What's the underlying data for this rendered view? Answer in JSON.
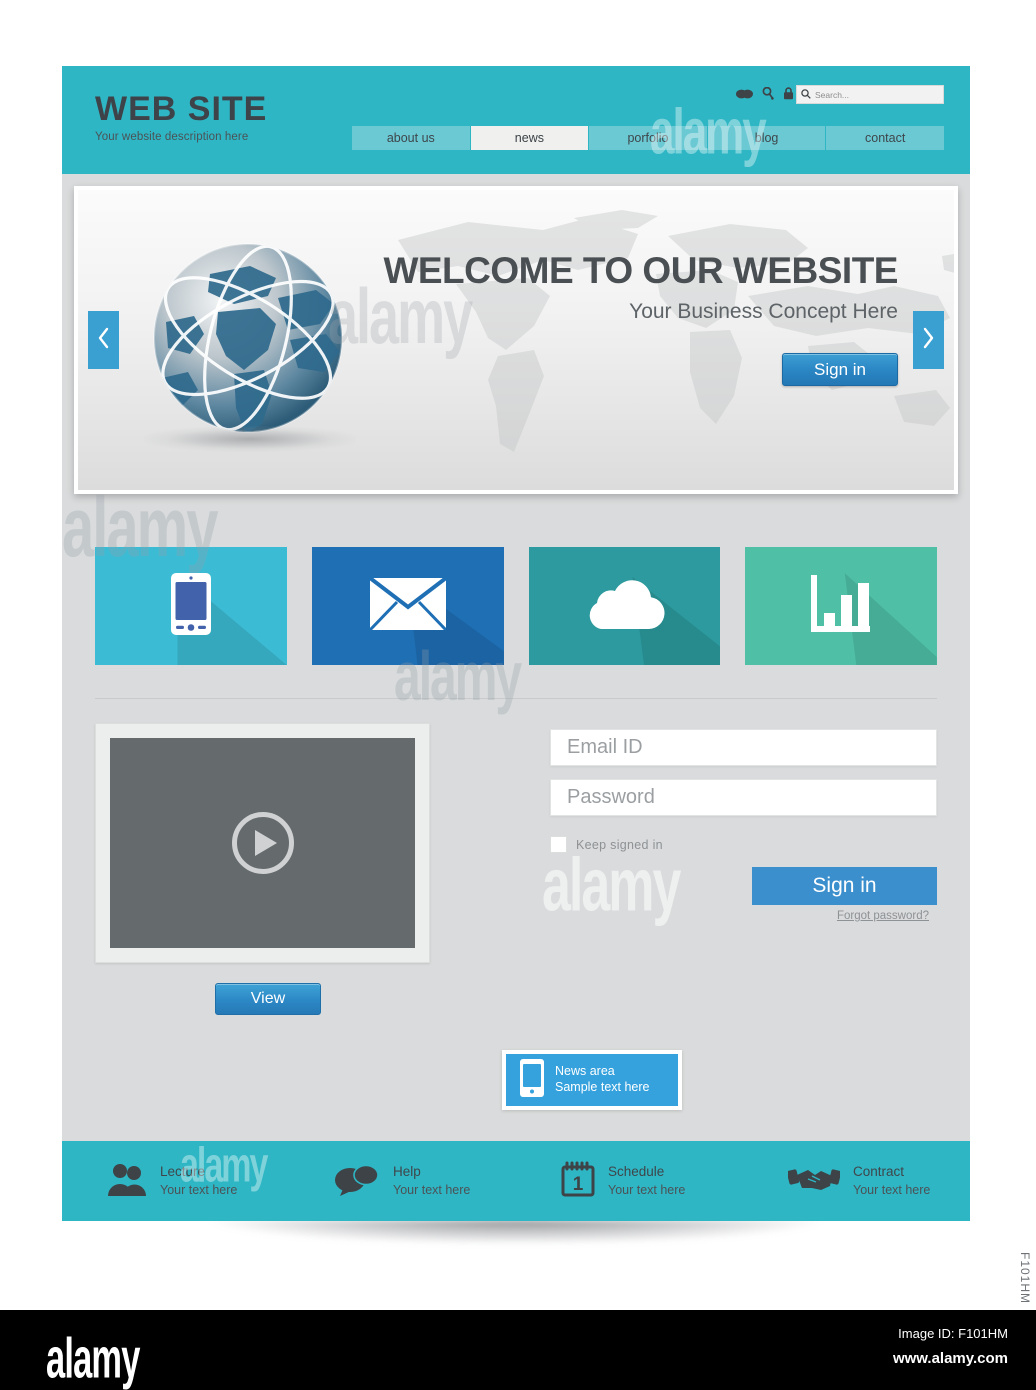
{
  "header": {
    "logo_title": "WEB SITE",
    "logo_subtitle": "Your website description here",
    "icons": [
      "chat-bubbles-icon",
      "key-icon",
      "lock-icon"
    ],
    "search": {
      "placeholder": "Search...",
      "value": "",
      "icon": "search-icon"
    },
    "nav": [
      {
        "label": "about us",
        "active": false
      },
      {
        "label": "news",
        "active": true
      },
      {
        "label": "porfolio",
        "active": false
      },
      {
        "label": "blog",
        "active": false
      },
      {
        "label": "contact",
        "active": false
      }
    ]
  },
  "hero": {
    "title": "WELCOME TO OUR WEBSITE",
    "subtitle": "Your Business Concept Here",
    "signin_label": "Sign in",
    "prev_icon": "chevron-left-icon",
    "next_icon": "chevron-right-icon",
    "globe_icon": "globe-icon",
    "background_icon": "world-map-icon"
  },
  "tiles": [
    {
      "name": "mobile",
      "icon": "smartphone-icon",
      "color": "#3cbcd4"
    },
    {
      "name": "email",
      "icon": "envelope-icon",
      "color": "#1f6fb5"
    },
    {
      "name": "cloud",
      "icon": "cloud-icon",
      "color": "#2c9a9e"
    },
    {
      "name": "analytics",
      "icon": "bar-chart-icon",
      "color": "#4fc0a6"
    }
  ],
  "media": {
    "play_icon": "play-button-icon",
    "view_label": "View"
  },
  "login": {
    "email_placeholder": "Email ID",
    "email_value": "",
    "password_placeholder": "Password",
    "password_value": "",
    "keep_signed_label": "Keep  signed  in",
    "keep_signed_checked": false,
    "signin_label": "Sign in",
    "forgot_label": "Forgot password?"
  },
  "news_widget": {
    "icon": "smartphone-icon",
    "line1": "News area",
    "line2": "Sample text here"
  },
  "footer": [
    {
      "icon": "people-icon",
      "title": "Lecture",
      "subtitle": "Your text here"
    },
    {
      "icon": "speech-bubbles-icon",
      "title": "Help",
      "subtitle": "Your text here"
    },
    {
      "icon": "calendar-icon",
      "calendar_day": "1",
      "title": "Schedule",
      "subtitle": "Your text here"
    },
    {
      "icon": "handshake-icon",
      "title": "Contract",
      "subtitle": "Your text here"
    }
  ],
  "watermark": {
    "text": "alamy",
    "logo": "alamy",
    "image_id": "Image ID: F101HM",
    "url": "www.alamy.com",
    "side_id": "F101HM"
  },
  "colors": {
    "teal": "#2fb6c4",
    "nav_teal": "#6bc9d4",
    "blue": "#2d89c6",
    "page_bg": "#d9dbdc"
  }
}
